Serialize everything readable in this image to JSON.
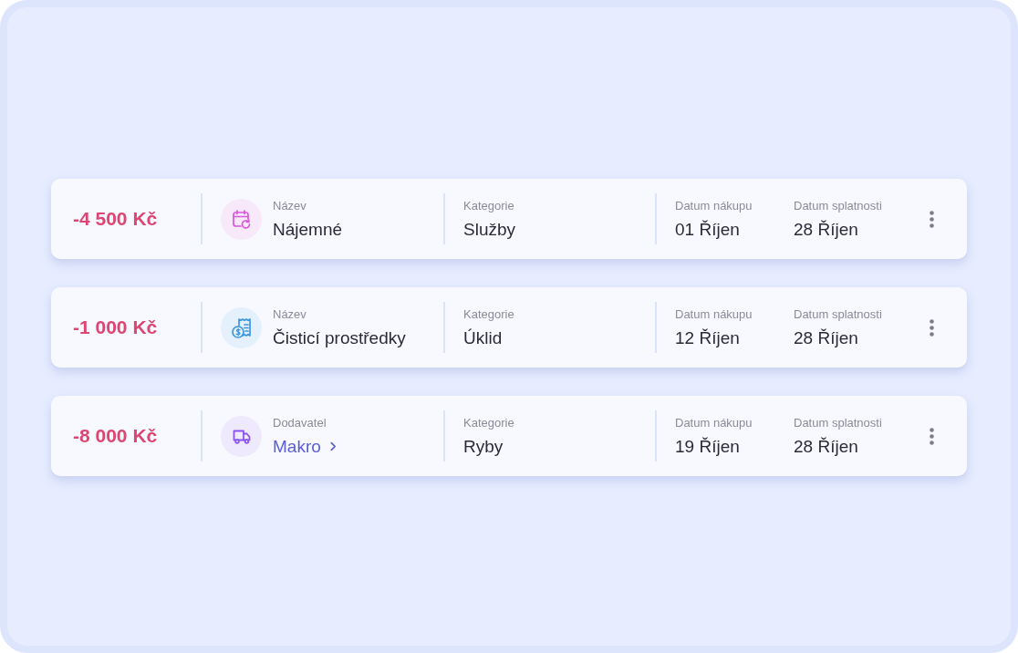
{
  "expenses": [
    {
      "amount": "-4 500 Kč",
      "name": {
        "kind": "text",
        "label": "Název",
        "value": "Nájemné"
      },
      "category": {
        "label": "Kategorie",
        "value": "Služby"
      },
      "purchase_date": {
        "label": "Datum nákupu",
        "value": "01 Říjen"
      },
      "due_date": {
        "label": "Datum splatnosti",
        "value": "28 Říjen"
      }
    },
    {
      "amount": "-1 000 Kč",
      "name": {
        "kind": "text",
        "label": "Název",
        "value": "Čisticí prostředky"
      },
      "category": {
        "label": "Kategorie",
        "value": "Úklid"
      },
      "purchase_date": {
        "label": "Datum nákupu",
        "value": "12 Říjen"
      },
      "due_date": {
        "label": "Datum splatnosti",
        "value": "28 Říjen"
      }
    },
    {
      "amount": "-8 000 Kč",
      "name": {
        "kind": "link",
        "label": "Dodavatel",
        "value": "Makro"
      },
      "category": {
        "label": "Kategorie",
        "value": "Ryby"
      },
      "purchase_date": {
        "label": "Datum nákupu",
        "value": "19 Říjen"
      },
      "due_date": {
        "label": "Datum splatnosti",
        "value": "28 Říjen"
      }
    }
  ]
}
